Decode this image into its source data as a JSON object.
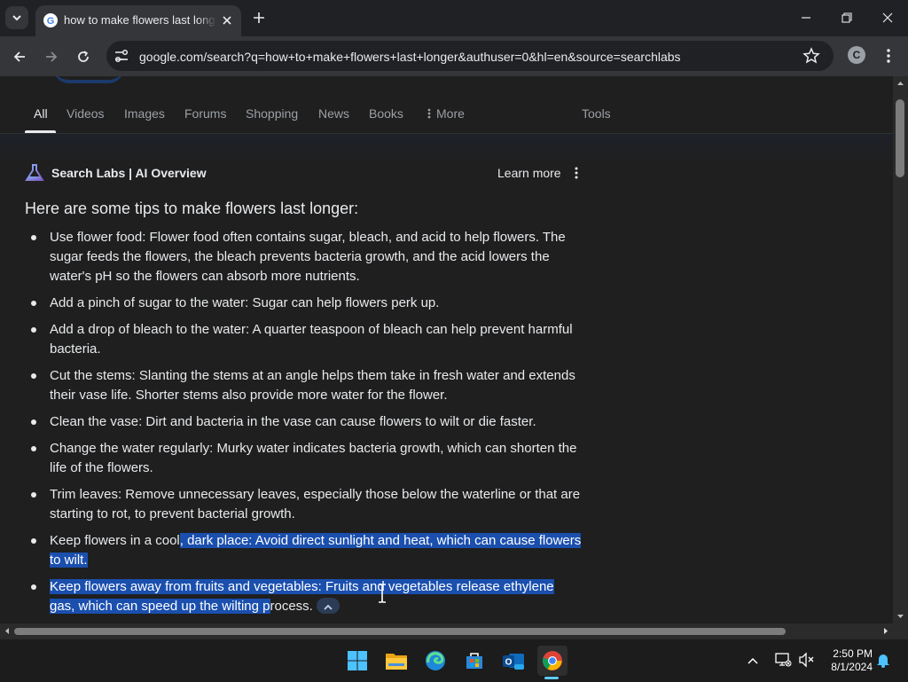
{
  "browser": {
    "tab_title": "how to make flowers last longer",
    "url": "google.com/search?q=how+to+make+flowers+last+longer&authuser=0&hl=en&source=searchlabs",
    "profile_initial": "C"
  },
  "search_tabs": [
    "All",
    "Videos",
    "Images",
    "Forums",
    "Shopping",
    "News",
    "Books",
    "More",
    "Tools"
  ],
  "ai_overview": {
    "header": "Search Labs | AI Overview",
    "learn_more": "Learn more",
    "intro": "Here are some tips to make flowers last longer:",
    "tips": [
      {
        "text": "Use flower food: Flower food often contains sugar, bleach, and acid to help flowers. The sugar feeds the flowers, the bleach prevents bacteria growth, and the acid lowers the water's pH so the flowers can absorb more nutrients."
      },
      {
        "text": "Add a pinch of sugar to the water: Sugar can help flowers perk up."
      },
      {
        "text": "Add a drop of bleach to the water: A quarter teaspoon of bleach can help prevent harmful bacteria."
      },
      {
        "text": "Cut the stems: Slanting the stems at an angle helps them take in fresh water and extends their vase life. Shorter stems also provide more water for the flower."
      },
      {
        "text": "Clean the vase: Dirt and bacteria in the vase can cause flowers to wilt or die faster."
      },
      {
        "text": "Change the water regularly: Murky water indicates bacteria growth, which can shorten the life of the flowers."
      },
      {
        "text": "Trim leaves: Remove unnecessary leaves, especially those below the waterline or that are starting to rot, to prevent bacterial growth."
      },
      {
        "plain": "Keep flowers in a cool",
        "selected": ", dark place: Avoid direct sunlight and heat, which can cause flowers to wilt."
      },
      {
        "selected": "Keep flowers away from fruits and vegetables: Fruits and vegetables release ethylene gas, which can speed up the wilting p",
        "plain": "rocess."
      }
    ]
  },
  "taskbar": {
    "time": "2:50 PM",
    "date": "8/1/2024",
    "apps": [
      "start-icon",
      "file-explorer-icon",
      "edge-icon",
      "microsoft-store-icon",
      "outlook-icon",
      "chrome-icon"
    ]
  }
}
